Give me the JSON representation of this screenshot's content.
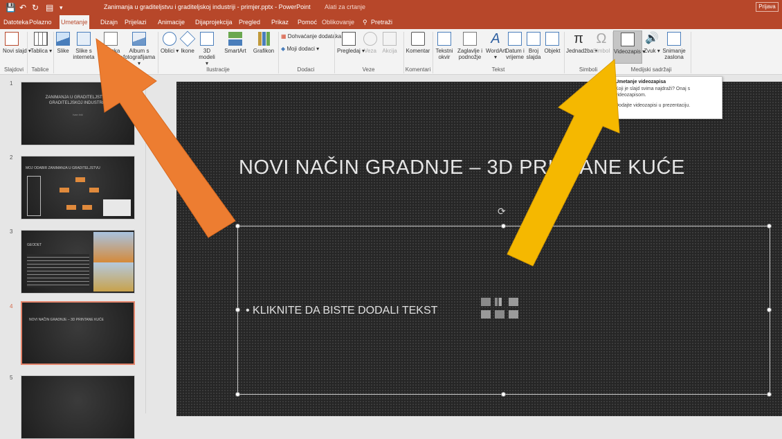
{
  "window": {
    "title": "Zanimanja u graditeljstvu i graditeljskoj industriji - primjer.pptx - PowerPoint",
    "context_tab": "Alati za crtanje",
    "signin": "Prijava"
  },
  "quick_access": {
    "save": "💾",
    "undo": "↶",
    "redo": "↻",
    "present": "▤",
    "more": "▾"
  },
  "tabs": [
    "Datoteka",
    "Polazno",
    "Umetanje",
    "Dizajn",
    "Prijelazi",
    "Animacije",
    "Dijaprojekcija",
    "Pregled",
    "Prikaz",
    "Pomoć",
    "Oblikovanje",
    "Pretraži"
  ],
  "ribbon": {
    "buttons": {
      "novi_slajd": "Novi slajd ▾",
      "tablica": "Tablica ▾",
      "slike": "Slike",
      "slike_internet": "Slike s interneta",
      "snimka": "Snimka zaslona ▾",
      "album": "Album s fotografijama ▾",
      "oblici": "Oblici ▾",
      "ikone": "Ikone",
      "modeli": "3D modeli ▾",
      "smartart": "SmartArt",
      "grafikon": "Grafikon",
      "dohvacanje": "Dohvaćanje dodataka",
      "moji_dodaci": "Moji dodaci ▾",
      "pregledaj": "Pregledaj ▾",
      "veza": "Veza",
      "akcija": "Akcija",
      "komentar": "Komentar",
      "tekstni_okvir": "Tekstni okvir",
      "zaglavlje": "Zaglavlje i podnožje",
      "wordart": "WordArt ▾",
      "datum": "Datum i vrijeme",
      "broj_slajda": "Broj slajda",
      "objekt": "Objekt",
      "jednadzba": "Jednadžba ▾",
      "simbol": "Simbol",
      "videozapis": "Videozapis ▾",
      "zvuk": "Zvuk ▾",
      "snimanje": "Snimanje zaslona"
    },
    "groups": [
      "Slajdovi",
      "Tablice",
      "Slike",
      "Ilustracije",
      "Dodaci",
      "Veze",
      "Komentari",
      "Tekst",
      "Simboli",
      "Medijski sadržaji"
    ]
  },
  "tooltip": {
    "title": "Umetanje videozapisa",
    "line1": "Koji je slajd svima najdraži? Onaj s videozapisom.",
    "line2": "Dodajte videozapisi u prezentaciju."
  },
  "thumbnails": [
    {
      "number": "1",
      "title": "ZANIMANJA U GRADITELJSTVU I GRADITELJSKOJ INDUSTRIJI",
      "sub": "Ivan Ivić"
    },
    {
      "number": "2",
      "title": "MOJ ODABIR ZANIMANJA U GRADITELJSTVU"
    },
    {
      "number": "3",
      "title": "GEODET"
    },
    {
      "number": "4",
      "title": "NOVI NAČIN GRADNJE – 3D PRINTANE KUĆE"
    },
    {
      "number": "5",
      "title": ""
    }
  ],
  "slide": {
    "title": "NOVI NAČIN GRADNJE – 3D PRINTANE KUĆE",
    "bullet": "•  KLIKNITE DA BISTE DODALI TEKST"
  },
  "annotations": {
    "arrow_left_color": "#ed7d31",
    "arrow_right_color": "#f5b800"
  },
  "colors": {
    "ribbon_accent": "#b7472a",
    "slide_bg": "#262626"
  }
}
